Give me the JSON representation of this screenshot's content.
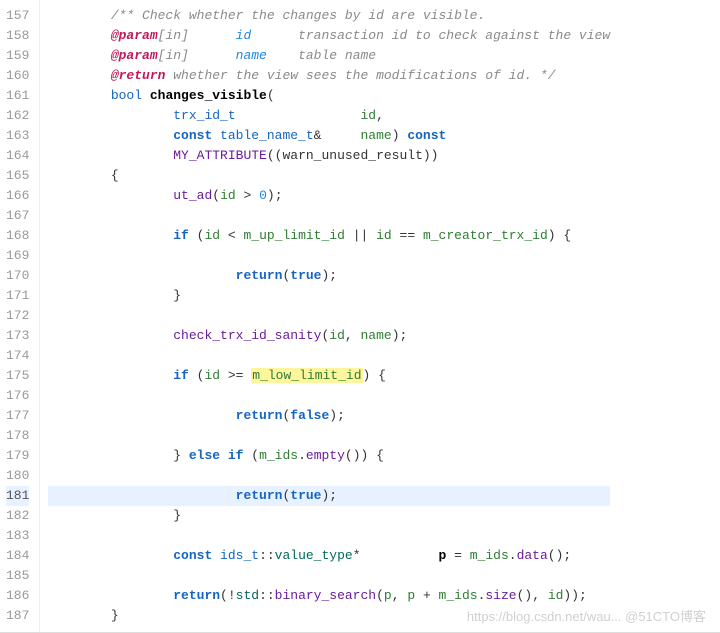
{
  "editor": {
    "startLine": 157,
    "endLine": 187,
    "currentLine": 181,
    "highlightedSymbol": "m_low_limit_id",
    "lines": {
      "157": {
        "indent": 8,
        "tokens": [
          {
            "t": "c-comment",
            "v": "/** Check whether the changes by id are visible."
          }
        ]
      },
      "158": {
        "indent": 8,
        "tokens": [
          {
            "t": "c-doc-tag",
            "v": "@param"
          },
          {
            "t": "c-comment",
            "v": "[in]      "
          },
          {
            "t": "c-doc-param",
            "v": "id"
          },
          {
            "t": "c-comment",
            "v": "      transaction id to check against the view"
          }
        ]
      },
      "159": {
        "indent": 8,
        "tokens": [
          {
            "t": "c-doc-tag",
            "v": "@param"
          },
          {
            "t": "c-comment",
            "v": "[in]      "
          },
          {
            "t": "c-doc-param",
            "v": "name"
          },
          {
            "t": "c-comment",
            "v": "    table name"
          }
        ]
      },
      "160": {
        "indent": 8,
        "tokens": [
          {
            "t": "c-doc-tag",
            "v": "@return"
          },
          {
            "t": "c-comment",
            "v": " whether the view sees the modifications of id. */"
          }
        ]
      },
      "161": {
        "indent": 8,
        "tokens": [
          {
            "t": "c-type",
            "v": "bool "
          },
          {
            "t": "c-def",
            "v": "changes_visible"
          },
          {
            "t": "c-punct",
            "v": "("
          }
        ]
      },
      "162": {
        "indent": 16,
        "tokens": [
          {
            "t": "c-type",
            "v": "trx_id_t"
          },
          {
            "t": "",
            "v": "                "
          },
          {
            "t": "c-ident",
            "v": "id"
          },
          {
            "t": "c-punct",
            "v": ","
          }
        ]
      },
      "163": {
        "indent": 16,
        "tokens": [
          {
            "t": "c-keyword",
            "v": "const "
          },
          {
            "t": "c-type",
            "v": "table_name_t"
          },
          {
            "t": "c-punct",
            "v": "&"
          },
          {
            "t": "",
            "v": "     "
          },
          {
            "t": "c-ident",
            "v": "name"
          },
          {
            "t": "c-punct",
            "v": ") "
          },
          {
            "t": "c-keyword",
            "v": "const"
          }
        ]
      },
      "164": {
        "indent": 16,
        "tokens": [
          {
            "t": "c-func",
            "v": "MY_ATTRIBUTE"
          },
          {
            "t": "c-punct",
            "v": "((warn_unused_result))"
          }
        ]
      },
      "165": {
        "indent": 8,
        "tokens": [
          {
            "t": "c-punct",
            "v": "{"
          }
        ]
      },
      "166": {
        "indent": 16,
        "tokens": [
          {
            "t": "c-func",
            "v": "ut_ad"
          },
          {
            "t": "c-punct",
            "v": "("
          },
          {
            "t": "c-ident",
            "v": "id"
          },
          {
            "t": "c-punct",
            "v": " > "
          },
          {
            "t": "c-num",
            "v": "0"
          },
          {
            "t": "c-punct",
            "v": ");"
          }
        ]
      },
      "167": {
        "indent": 0,
        "tokens": []
      },
      "168": {
        "indent": 16,
        "tokens": [
          {
            "t": "c-keyword",
            "v": "if"
          },
          {
            "t": "c-punct",
            "v": " ("
          },
          {
            "t": "c-ident",
            "v": "id"
          },
          {
            "t": "c-punct",
            "v": " < "
          },
          {
            "t": "c-ident",
            "v": "m_up_limit_id"
          },
          {
            "t": "c-punct",
            "v": " || "
          },
          {
            "t": "c-ident",
            "v": "id"
          },
          {
            "t": "c-punct",
            "v": " == "
          },
          {
            "t": "c-ident",
            "v": "m_creator_trx_id"
          },
          {
            "t": "c-punct",
            "v": ") {"
          }
        ]
      },
      "169": {
        "indent": 0,
        "tokens": []
      },
      "170": {
        "indent": 24,
        "tokens": [
          {
            "t": "c-keyword",
            "v": "return"
          },
          {
            "t": "c-punct",
            "v": "("
          },
          {
            "t": "c-keyword",
            "v": "true"
          },
          {
            "t": "c-punct",
            "v": ");"
          }
        ]
      },
      "171": {
        "indent": 16,
        "tokens": [
          {
            "t": "c-punct",
            "v": "}"
          }
        ]
      },
      "172": {
        "indent": 0,
        "tokens": []
      },
      "173": {
        "indent": 16,
        "tokens": [
          {
            "t": "c-func",
            "v": "check_trx_id_sanity"
          },
          {
            "t": "c-punct",
            "v": "("
          },
          {
            "t": "c-ident",
            "v": "id"
          },
          {
            "t": "c-punct",
            "v": ", "
          },
          {
            "t": "c-ident",
            "v": "name"
          },
          {
            "t": "c-punct",
            "v": ");"
          }
        ]
      },
      "174": {
        "indent": 0,
        "tokens": []
      },
      "175": {
        "indent": 16,
        "tokens": [
          {
            "t": "c-keyword",
            "v": "if"
          },
          {
            "t": "c-punct",
            "v": " ("
          },
          {
            "t": "c-ident",
            "v": "id"
          },
          {
            "t": "c-punct",
            "v": " >= "
          },
          {
            "t": "c-ident-hl",
            "v": "m_low_limit_id"
          },
          {
            "t": "c-punct",
            "v": ") {"
          }
        ]
      },
      "176": {
        "indent": 0,
        "tokens": []
      },
      "177": {
        "indent": 24,
        "tokens": [
          {
            "t": "c-keyword",
            "v": "return"
          },
          {
            "t": "c-punct",
            "v": "("
          },
          {
            "t": "c-keyword",
            "v": "false"
          },
          {
            "t": "c-punct",
            "v": ");"
          }
        ]
      },
      "178": {
        "indent": 0,
        "tokens": []
      },
      "179": {
        "indent": 16,
        "tokens": [
          {
            "t": "c-punct",
            "v": "} "
          },
          {
            "t": "c-keyword",
            "v": "else if"
          },
          {
            "t": "c-punct",
            "v": " ("
          },
          {
            "t": "c-ident",
            "v": "m_ids"
          },
          {
            "t": "c-punct",
            "v": "."
          },
          {
            "t": "c-func",
            "v": "empty"
          },
          {
            "t": "c-punct",
            "v": "()) {"
          }
        ]
      },
      "180": {
        "indent": 0,
        "tokens": []
      },
      "181": {
        "indent": 24,
        "tokens": [
          {
            "t": "c-keyword",
            "v": "return"
          },
          {
            "t": "c-punct",
            "v": "("
          },
          {
            "t": "c-keyword",
            "v": "true"
          },
          {
            "t": "c-punct",
            "v": ");"
          }
        ]
      },
      "182": {
        "indent": 16,
        "tokens": [
          {
            "t": "c-punct",
            "v": "}"
          }
        ]
      },
      "183": {
        "indent": 0,
        "tokens": []
      },
      "184": {
        "indent": 16,
        "tokens": [
          {
            "t": "c-keyword",
            "v": "const "
          },
          {
            "t": "c-type",
            "v": "ids_t"
          },
          {
            "t": "c-punct",
            "v": "::"
          },
          {
            "t": "c-ns",
            "v": "value_type"
          },
          {
            "t": "c-punct",
            "v": "*"
          },
          {
            "t": "",
            "v": "          "
          },
          {
            "t": "c-def",
            "v": "p"
          },
          {
            "t": "c-punct",
            "v": " = "
          },
          {
            "t": "c-ident",
            "v": "m_ids"
          },
          {
            "t": "c-punct",
            "v": "."
          },
          {
            "t": "c-func",
            "v": "data"
          },
          {
            "t": "c-punct",
            "v": "();"
          }
        ]
      },
      "185": {
        "indent": 0,
        "tokens": []
      },
      "186": {
        "indent": 16,
        "tokens": [
          {
            "t": "c-keyword",
            "v": "return"
          },
          {
            "t": "c-punct",
            "v": "(!"
          },
          {
            "t": "c-ns",
            "v": "std"
          },
          {
            "t": "c-punct",
            "v": "::"
          },
          {
            "t": "c-func",
            "v": "binary_search"
          },
          {
            "t": "c-punct",
            "v": "("
          },
          {
            "t": "c-ident",
            "v": "p"
          },
          {
            "t": "c-punct",
            "v": ", "
          },
          {
            "t": "c-ident",
            "v": "p"
          },
          {
            "t": "c-punct",
            "v": " + "
          },
          {
            "t": "c-ident",
            "v": "m_ids"
          },
          {
            "t": "c-punct",
            "v": "."
          },
          {
            "t": "c-func",
            "v": "size"
          },
          {
            "t": "c-punct",
            "v": "(), "
          },
          {
            "t": "c-ident",
            "v": "id"
          },
          {
            "t": "c-punct",
            "v": "));"
          }
        ]
      },
      "187": {
        "indent": 8,
        "tokens": [
          {
            "t": "c-punct",
            "v": "}"
          }
        ]
      }
    }
  },
  "watermark": "https://blog.csdn.net/wau... @51CTO博客"
}
